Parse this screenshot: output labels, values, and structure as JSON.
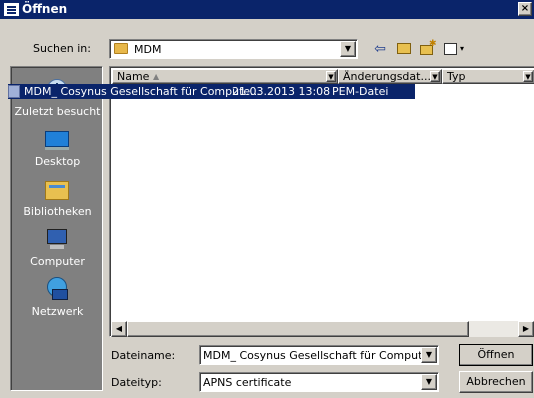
{
  "window": {
    "title": "Öffnen",
    "close_glyph": "×"
  },
  "toolbar": {
    "look_in_label": "Suchen in:",
    "look_in_value": "MDM",
    "icons": [
      "back-arrow-icon",
      "up-folder-icon",
      "new-folder-icon",
      "view-menu-icon"
    ]
  },
  "places": [
    {
      "label": "Zuletzt besucht",
      "icon": "recent-places-icon"
    },
    {
      "label": "Desktop",
      "icon": "desktop-icon"
    },
    {
      "label": "Bibliotheken",
      "icon": "libraries-icon"
    },
    {
      "label": "Computer",
      "icon": "computer-icon"
    },
    {
      "label": "Netzwerk",
      "icon": "network-icon"
    }
  ],
  "filelist": {
    "columns": [
      "Name",
      "Änderungsdat...",
      "Typ"
    ],
    "rows": [
      {
        "name": "MDM_ Cosynus Gesellschaft für Compute...",
        "modified": "21.03.2013 13:08",
        "type": "PEM-Datei"
      }
    ]
  },
  "form": {
    "filename_label": "Dateiname:",
    "filename_value": "MDM_ Cosynus Gesellschaft für Computersyster",
    "filetype_label": "Dateityp:",
    "filetype_value": "APNS certificate",
    "open_label": "Öffnen",
    "cancel_label": "Abbrechen"
  },
  "colors": {
    "titlebar": "#0a246a",
    "face": "#d4d0c8",
    "places_bg": "#808080",
    "selection": "#0a246a"
  }
}
